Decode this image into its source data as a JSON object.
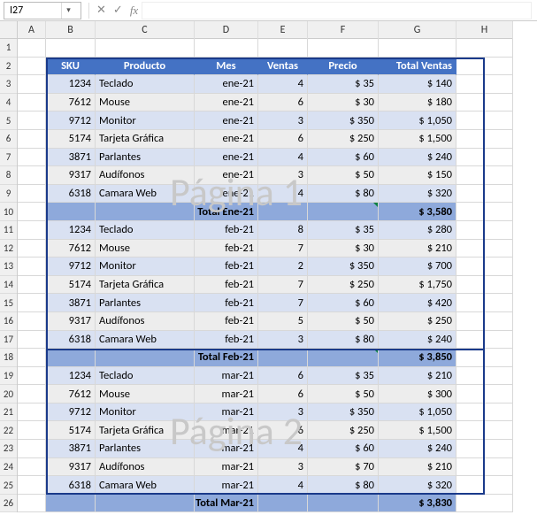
{
  "namebox": {
    "ref": "I27"
  },
  "fx": {
    "cancel": "✕",
    "confirm": "✓",
    "fx": "fx"
  },
  "columns": [
    "A",
    "B",
    "C",
    "D",
    "E",
    "F",
    "G",
    "H"
  ],
  "row_numbers": [
    1,
    2,
    3,
    4,
    5,
    6,
    7,
    8,
    9,
    10,
    11,
    12,
    13,
    14,
    15,
    16,
    17,
    18,
    19,
    20,
    21,
    22,
    23,
    24,
    25,
    26
  ],
  "headers": {
    "sku": "SKU",
    "producto": "Producto",
    "mes": "Mes",
    "ventas": "Ventas",
    "precio": "Precio",
    "total": "Total Ventas"
  },
  "data": [
    {
      "sku": "1234",
      "prod": "Teclado",
      "mes": "ene-21",
      "ventas": "4",
      "precio": "$ 35",
      "total": "$ 140"
    },
    {
      "sku": "7612",
      "prod": "Mouse",
      "mes": "ene-21",
      "ventas": "6",
      "precio": "$ 30",
      "total": "$ 180"
    },
    {
      "sku": "9712",
      "prod": "Monitor",
      "mes": "ene-21",
      "ventas": "3",
      "precio": "$ 350",
      "total": "$ 1,050"
    },
    {
      "sku": "5174",
      "prod": "Tarjeta Gráfica",
      "mes": "ene-21",
      "ventas": "6",
      "precio": "$ 250",
      "total": "$ 1,500"
    },
    {
      "sku": "3871",
      "prod": "Parlantes",
      "mes": "ene-21",
      "ventas": "4",
      "precio": "$ 60",
      "total": "$ 240"
    },
    {
      "sku": "9317",
      "prod": "Audífonos",
      "mes": "ene-21",
      "ventas": "3",
      "precio": "$ 50",
      "total": "$ 150"
    },
    {
      "sku": "6318",
      "prod": "Camara Web",
      "mes": "ene-21",
      "ventas": "4",
      "precio": "$ 80",
      "total": "$ 320"
    }
  ],
  "sub1": {
    "label": "Total Ene-21",
    "total": "$ 3,580"
  },
  "data2": [
    {
      "sku": "1234",
      "prod": "Teclado",
      "mes": "feb-21",
      "ventas": "8",
      "precio": "$ 35",
      "total": "$ 280"
    },
    {
      "sku": "7612",
      "prod": "Mouse",
      "mes": "feb-21",
      "ventas": "7",
      "precio": "$ 30",
      "total": "$ 210"
    },
    {
      "sku": "9712",
      "prod": "Monitor",
      "mes": "feb-21",
      "ventas": "2",
      "precio": "$ 350",
      "total": "$ 700"
    },
    {
      "sku": "5174",
      "prod": "Tarjeta Gráfica",
      "mes": "feb-21",
      "ventas": "7",
      "precio": "$ 250",
      "total": "$ 1,750"
    },
    {
      "sku": "3871",
      "prod": "Parlantes",
      "mes": "feb-21",
      "ventas": "7",
      "precio": "$ 60",
      "total": "$ 420"
    },
    {
      "sku": "9317",
      "prod": "Audífonos",
      "mes": "feb-21",
      "ventas": "5",
      "precio": "$ 50",
      "total": "$ 250"
    },
    {
      "sku": "6318",
      "prod": "Camara Web",
      "mes": "feb-21",
      "ventas": "3",
      "precio": "$ 80",
      "total": "$ 240"
    }
  ],
  "sub2": {
    "label": "Total Feb-21",
    "total": "$ 3,850"
  },
  "data3": [
    {
      "sku": "1234",
      "prod": "Teclado",
      "mes": "mar-21",
      "ventas": "6",
      "precio": "$ 35",
      "total": "$ 210"
    },
    {
      "sku": "7612",
      "prod": "Mouse",
      "mes": "mar-21",
      "ventas": "6",
      "precio": "$ 50",
      "total": "$ 300"
    },
    {
      "sku": "9712",
      "prod": "Monitor",
      "mes": "mar-21",
      "ventas": "3",
      "precio": "$ 350",
      "total": "$ 1,050"
    },
    {
      "sku": "5174",
      "prod": "Tarjeta Gráfica",
      "mes": "mar-21",
      "ventas": "6",
      "precio": "$ 250",
      "total": "$ 1,500"
    },
    {
      "sku": "3871",
      "prod": "Parlantes",
      "mes": "mar-21",
      "ventas": "4",
      "precio": "$ 60",
      "total": "$ 240"
    },
    {
      "sku": "9317",
      "prod": "Audífonos",
      "mes": "mar-21",
      "ventas": "3",
      "precio": "$ 70",
      "total": "$ 210"
    },
    {
      "sku": "6318",
      "prod": "Camara Web",
      "mes": "mar-21",
      "ventas": "4",
      "precio": "$ 80",
      "total": "$ 320"
    }
  ],
  "sub3": {
    "label": "Total Mar-21",
    "total": "$ 3,830"
  },
  "watermarks": {
    "p1": "Página 1",
    "p2": "Página 2"
  }
}
